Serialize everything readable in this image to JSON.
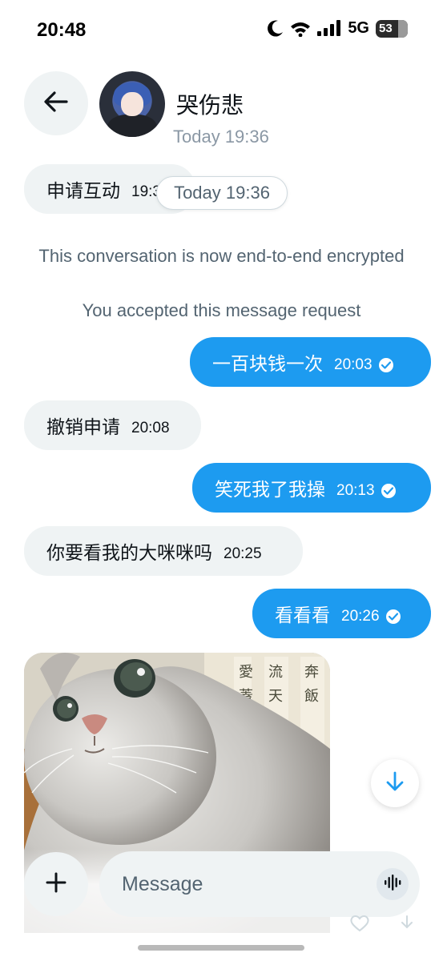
{
  "status_bar": {
    "time": "20:48",
    "network": "5G",
    "battery": "53"
  },
  "header": {
    "contact_name": "哭伤悲",
    "subtitle": "Today 19:36"
  },
  "date_pill": "Today 19:36",
  "messages": [
    {
      "side": "in",
      "text": "申请互动",
      "time": "19:36"
    },
    {
      "side": "out",
      "text": "一百块钱一次",
      "time": "20:03"
    },
    {
      "side": "in",
      "text": "撤销申请",
      "time": "20:08"
    },
    {
      "side": "out",
      "text": "笑死我了我操",
      "time": "20:13"
    },
    {
      "side": "in",
      "text": "你要看我的大咪咪吗",
      "time": "20:25"
    },
    {
      "side": "out",
      "text": "看看看",
      "time": "20:26"
    }
  ],
  "system_messages": {
    "encrypted": "This conversation is now end-to-end encrypted",
    "accepted": "You accepted this message request"
  },
  "composer": {
    "placeholder": "Message"
  },
  "colors": {
    "accent": "#1d9bf0",
    "incoming_bubble": "#eff3f4",
    "secondary_text": "#536471"
  },
  "icons": {
    "back": "arrow-left-icon",
    "scroll": "arrow-down-icon",
    "add": "plus-icon",
    "voice": "waveform-icon",
    "read": "check-circle-icon"
  }
}
